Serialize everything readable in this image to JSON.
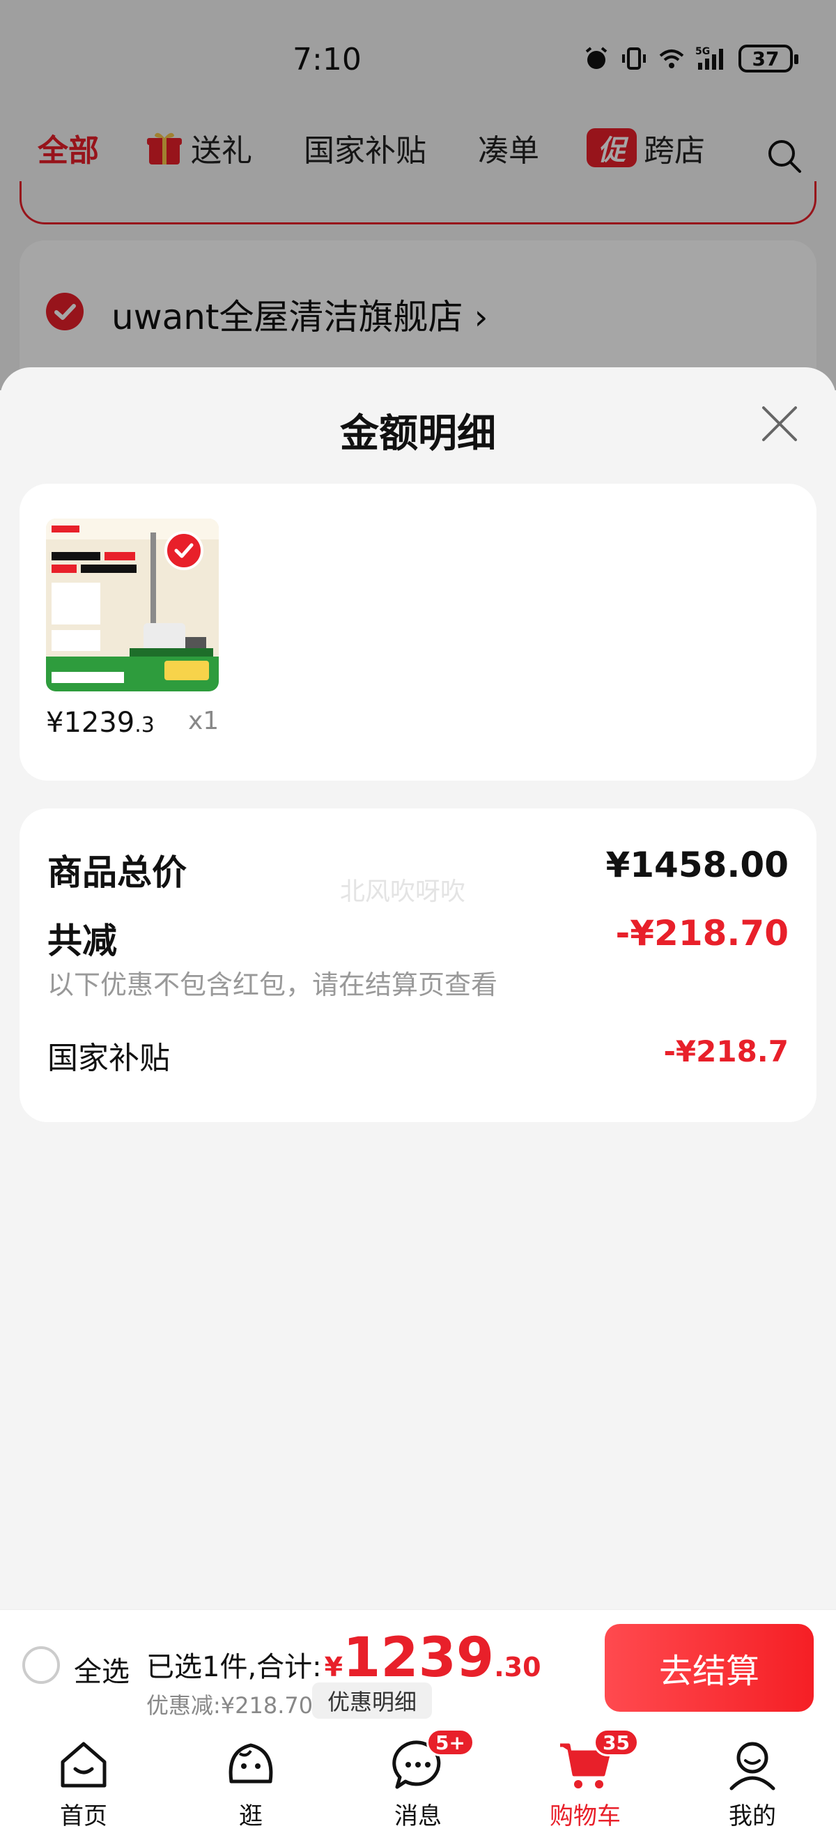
{
  "status_bar": {
    "time": "7:10",
    "network": "5G",
    "battery": "37"
  },
  "top_tabs": [
    {
      "label": "全部"
    },
    {
      "label": "送礼"
    },
    {
      "label": "国家补贴"
    },
    {
      "label": "凑单"
    },
    {
      "label": "跨店",
      "badge": "促"
    }
  ],
  "shop": {
    "name": "uwant全屋清洁旗舰店",
    "chevron": "›"
  },
  "sheet": {
    "title": "金额明细",
    "item": {
      "price_int": "¥1239",
      "price_dec": ".3",
      "qty": "x1"
    },
    "watermark": "北风吹呀吹",
    "summary": {
      "total_label": "商品总价",
      "total_value": "¥1458.00",
      "reduce_label": "共减",
      "reduce_value": "-¥218.70",
      "reduce_note": "以下优惠不包含红包，请在结算页查看",
      "subsidy_label": "国家补贴",
      "subsidy_value": "-¥218.7"
    }
  },
  "checkout": {
    "select_all": "全选",
    "selected_text": "已选1件,合计:",
    "currency": "¥",
    "total_int": "1239",
    "total_dec": ".30",
    "discount": "优惠减:¥218.70",
    "detail_chip": "优惠明细",
    "button": "去结算"
  },
  "bottom_nav": [
    {
      "label": "首页"
    },
    {
      "label": "逛"
    },
    {
      "label": "消息",
      "badge": "5+"
    },
    {
      "label": "购物车",
      "badge": "35"
    },
    {
      "label": "我的"
    }
  ],
  "colors": {
    "accent": "#e8202a",
    "background": "#f4f4f4"
  }
}
